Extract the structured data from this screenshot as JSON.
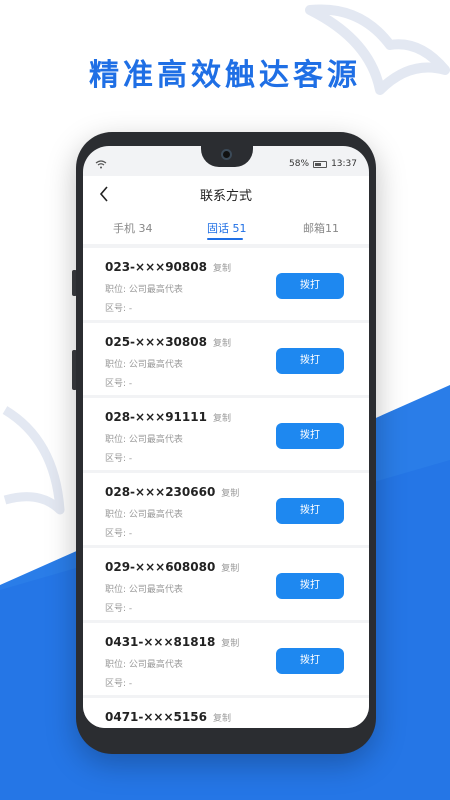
{
  "headline": "精准高效触达客源",
  "status": {
    "battery": "58%",
    "time": "13:37"
  },
  "appbar": {
    "title": "联系方式"
  },
  "tabs": [
    {
      "label": "手机 34"
    },
    {
      "label": "固话 51"
    },
    {
      "label": "邮箱11"
    }
  ],
  "rows": [
    {
      "number": "023-×××90808",
      "copy": "复制",
      "position": "职位: 公司最高代表",
      "area": "区号: -",
      "action": "拨打"
    },
    {
      "number": "025-×××30808",
      "copy": "复制",
      "position": "职位: 公司最高代表",
      "area": "区号: -",
      "action": "拨打"
    },
    {
      "number": "028-×××91111",
      "copy": "复制",
      "position": "职位: 公司最高代表",
      "area": "区号: -",
      "action": "拨打"
    },
    {
      "number": "028-×××230660",
      "copy": "复制",
      "position": "职位: 公司最高代表",
      "area": "区号: -",
      "action": "拨打"
    },
    {
      "number": "029-×××608080",
      "copy": "复制",
      "position": "职位: 公司最高代表",
      "area": "区号: -",
      "action": "拨打"
    },
    {
      "number": "0431-×××81818",
      "copy": "复制",
      "position": "职位: 公司最高代表",
      "area": "区号: -",
      "action": "拨打"
    },
    {
      "number": "0471-×××5156",
      "copy": "复制",
      "position": "",
      "area": "",
      "action": ""
    }
  ],
  "colors": {
    "brand": "#1f6fe5",
    "button": "#1e88f0"
  },
  "icons": {
    "back": "chevron-left-icon",
    "wifi": "wifi-icon",
    "battery": "battery-icon"
  }
}
